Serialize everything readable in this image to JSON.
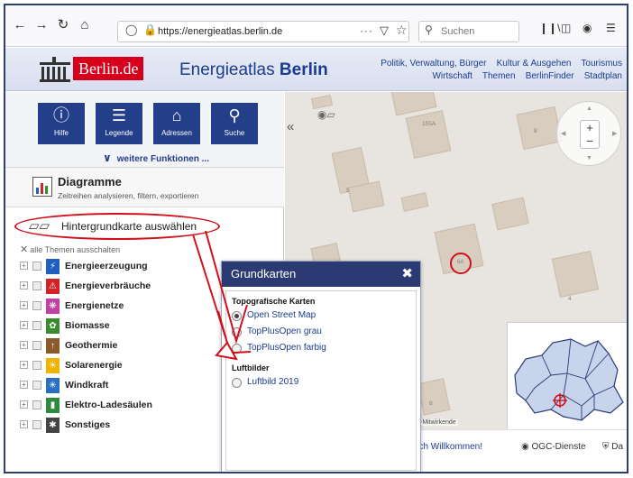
{
  "browser": {
    "url": "https://energieatlas.berlin.de",
    "page_actions": "···",
    "search_placeholder": "Suchen"
  },
  "header": {
    "logo_text": "Berlin.de",
    "title_main": "Energieatlas ",
    "title_bold": "Berlin",
    "links_row1": [
      "Politik, Verwaltung, Bürger",
      "Kultur & Ausgehen",
      "Tourismus"
    ],
    "links_row2": [
      "Wirtschaft",
      "Themen",
      "BerlinFinder",
      "Stadtplan"
    ]
  },
  "toolbar": {
    "tiles": [
      {
        "icon": "help-icon",
        "label": "Hilfe"
      },
      {
        "icon": "legend-icon",
        "label": "Legende"
      },
      {
        "icon": "address-icon",
        "label": "Adressen"
      },
      {
        "icon": "search-icon",
        "label": "Suche"
      }
    ],
    "more_label": "weitere Funktionen ..."
  },
  "diagramme": {
    "title": "Diagramme",
    "subtitle": "Zeitreihen analysieren, filtern, exportieren"
  },
  "background_map_label": "Hintergrundkarte auswählen",
  "all_themes_off": "alle Themen ausschalten",
  "themes": [
    {
      "label": "Energieerzeugung",
      "color": "#1f5fbf"
    },
    {
      "label": "Energieverbräuche",
      "color": "#d2232a"
    },
    {
      "label": "Energienetze",
      "color": "#c23fa3"
    },
    {
      "label": "Biomasse",
      "color": "#3a8a2e"
    },
    {
      "label": "Geothermie",
      "color": "#8a5a2b"
    },
    {
      "label": "Solarenergie",
      "color": "#f0b400"
    },
    {
      "label": "Windkraft",
      "color": "#2a6fc0"
    },
    {
      "label": "Elektro-Ladesäulen",
      "color": "#2e8b3e"
    },
    {
      "label": "Sonstiges",
      "color": "#444444"
    }
  ],
  "map": {
    "house_numbers": [
      "155A",
      "8",
      "5",
      "6A",
      "4",
      "8"
    ],
    "attribution": "-Mitwirkende"
  },
  "dialog": {
    "title": "Grundkarten",
    "group1": "Topografische Karten",
    "options1": [
      {
        "label": "Open Street Map",
        "selected": true
      },
      {
        "label": "TopPlusOpen grau",
        "selected": false
      },
      {
        "label": "TopPlusOpen farbig",
        "selected": false
      }
    ],
    "group2": "Luftbilder",
    "options2": [
      {
        "label": "Luftbild 2019",
        "selected": false
      }
    ]
  },
  "bottom": {
    "welcome": "lich Willkommen!",
    "ogc": "OGC-Dienste",
    "da": "Da"
  },
  "colors": {
    "brand_blue": "#243f8a",
    "berlin_red": "#d6001c",
    "annotation_red": "#d0111b"
  }
}
